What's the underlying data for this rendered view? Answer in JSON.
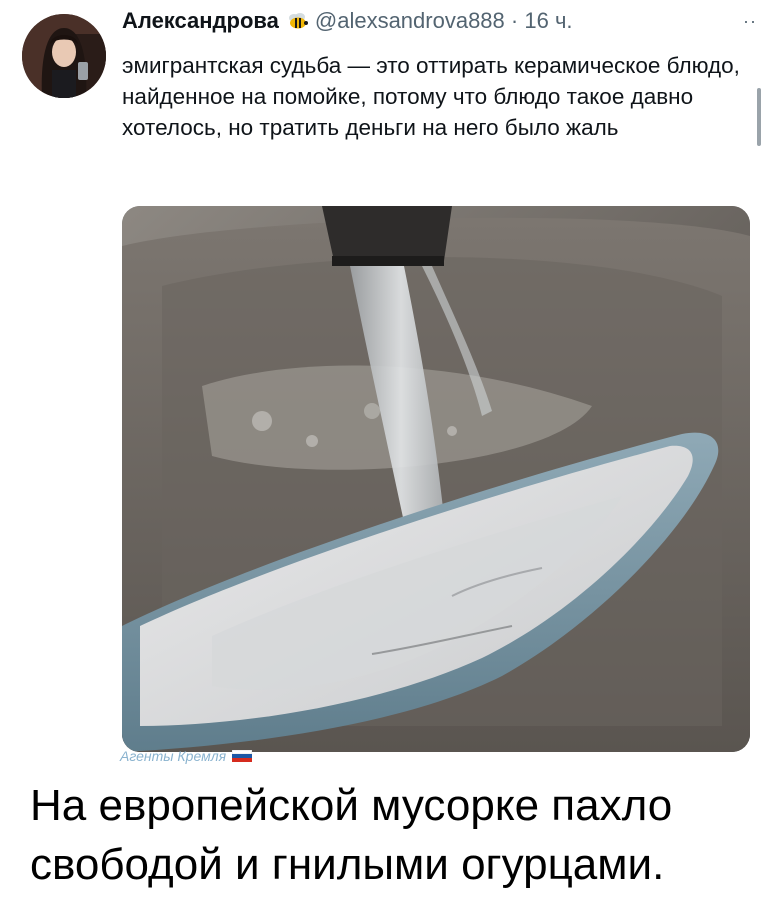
{
  "tweet": {
    "display_name": "Александрова",
    "handle": "@alexsandrova888",
    "separator": "·",
    "time": "16 ч.",
    "more_glyph": "··",
    "text": "эмигрантская судьба — это оттирать керамическое блюдо, найденное на помойке, потому что блюдо такое давно хотелось, но тратить деньги на него было жаль"
  },
  "icons": {
    "avatar": "avatar",
    "badge": "bee-icon",
    "more": "more-icon",
    "flag": "russian-flag-icon"
  },
  "photo": {
    "subject": "photo"
  },
  "watermark": {
    "text": "Агенты Кремля"
  },
  "caption": {
    "text": "На европейской мусорке пахло свободой и гнилыми огурцами."
  },
  "colors": {
    "text": "#0f1419",
    "secondary": "#536471",
    "watermark": "#8ab3cf",
    "caption": "#000000"
  }
}
